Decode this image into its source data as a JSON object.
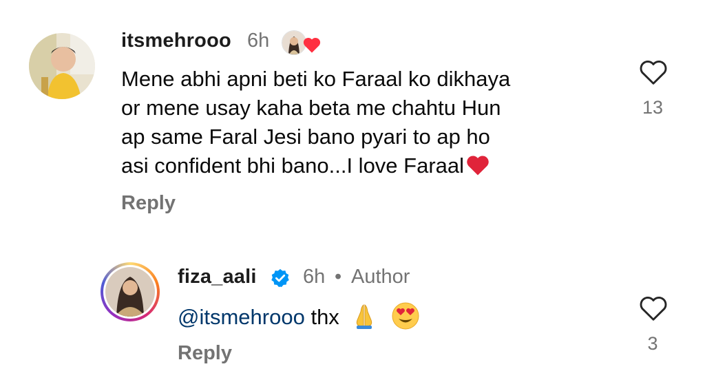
{
  "comment": {
    "username": "itsmehrooo",
    "time": "6h",
    "avatar_icon": "child-photo-avatar",
    "liked_by_author_icon": "author-avatar-heart-icon",
    "text_lines": [
      "Mene abhi apni beti ko Faraal ko dikhaya",
      "or mene usay kaha beta me chahtu Hun",
      "ap same Faral Jesi bano pyari to ap ho",
      "asi confident bhi bano...I love Faraal"
    ],
    "end_emoji": "red-heart",
    "reply_label": "Reply",
    "like_count": "13"
  },
  "reply_comment": {
    "username": "fiza_aali",
    "verified_icon": "verified-badge-icon",
    "time": "6h",
    "separator": "•",
    "author_label": "Author",
    "mention": "@itsmehrooo",
    "text": "thx",
    "emojis": [
      "folded-hands",
      "heart-eyes"
    ],
    "reply_label": "Reply",
    "like_count": "3"
  },
  "colors": {
    "username": "#1c1c1c",
    "meta": "#737373",
    "mention": "#00376b",
    "verified": "#0095f6",
    "heart": "#ff3040"
  }
}
